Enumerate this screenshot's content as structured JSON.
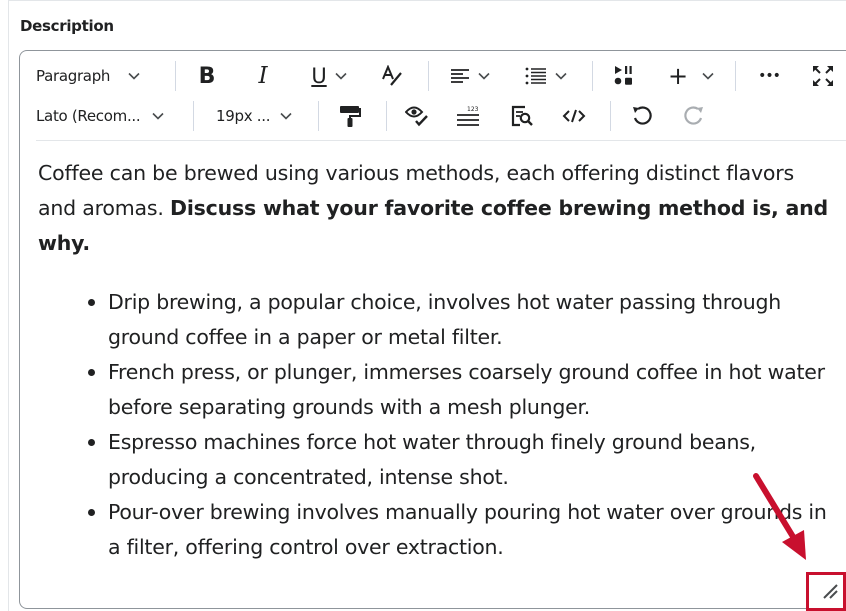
{
  "field": {
    "label": "Description"
  },
  "toolbar": {
    "block_format": "Paragraph",
    "font_family": "Lato (Recom...",
    "font_size": "19px ...",
    "icons": [
      "bold-icon",
      "italic-icon",
      "underline-icon",
      "text-color-icon",
      "align-icon",
      "list-icon",
      "media-icon",
      "insert-plus-icon",
      "more-icon",
      "fullscreen-icon",
      "format-painter-icon",
      "accessibility-checker-icon",
      "word-count-icon",
      "find-replace-icon",
      "source-code-icon",
      "undo-icon",
      "redo-icon"
    ],
    "bold_glyph": "B",
    "italic_glyph": "I",
    "underline_glyph": "U",
    "plus_glyph": "+",
    "more_glyph": "•••"
  },
  "content": {
    "intro_plain": "Coffee can be brewed using various methods, each offering distinct flavors and aromas. ",
    "intro_bold": "Discuss what your favorite coffee brewing method is, and why.",
    "bullets": [
      "Drip brewing, a popular choice, involves hot water passing through ground coffee in a paper or metal filter.",
      "French press, or plunger, immerses coarsely ground coffee in hot water before separating grounds with a mesh plunger.",
      "Espresso machines force hot water through finely ground beans, producing a concentrated, intense shot.",
      "Pour-over brewing involves manually pouring hot water over grounds in a filter, offering control over extraction."
    ]
  },
  "colors": {
    "annotation": "#c8102e",
    "border": "#8f959b",
    "text": "#202122"
  }
}
